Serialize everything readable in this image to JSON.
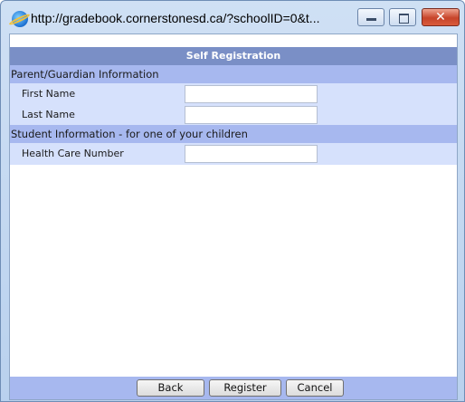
{
  "window": {
    "title": "http://gradebook.cornerstonesd.ca/?schoolID=0&t...",
    "controls": {
      "minimize": "",
      "maximize": "",
      "close": "✕"
    }
  },
  "form": {
    "title": "Self Registration",
    "parent_section": "Parent/Guardian Information",
    "first_name_label": "First Name",
    "first_name_value": "",
    "last_name_label": "Last Name",
    "last_name_value": "",
    "student_section": "Student Information - for one of your children",
    "health_label": "Health Care Number",
    "health_value": ""
  },
  "buttons": {
    "back": "Back",
    "register": "Register",
    "cancel": "Cancel"
  },
  "colors": {
    "header": "#7a8fc6",
    "section": "#a7b8ef",
    "row": "#d6e1fc"
  }
}
